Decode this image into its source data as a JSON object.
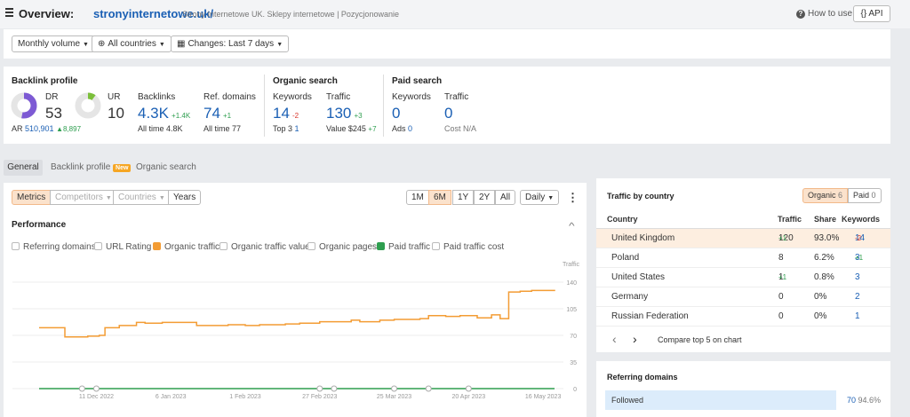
{
  "header": {
    "title_prefix": "Overview:",
    "domain": "stronyinternetowe.uk/",
    "description": "Strony Internetowe UK. Sklepy internetowe | Pozycjonowanie",
    "how_to_use": "How to use",
    "api": "{} API"
  },
  "filters": {
    "volume": "Monthly volume",
    "countries": "All countries",
    "changes": "Changes: Last 7 days"
  },
  "overview": {
    "backlink_profile": {
      "title": "Backlink profile",
      "dr_label": "DR",
      "dr_value": "53",
      "ur_label": "UR",
      "ur_value": "10",
      "backlinks_label": "Backlinks",
      "backlinks_value": "4.3K",
      "backlinks_delta": "+1.4K",
      "backlinks_alltime": "All time 4.8K",
      "refdomains_label": "Ref. domains",
      "refdomains_value": "74",
      "refdomains_delta": "+1",
      "refdomains_alltime": "All time 77",
      "ar_label": "AR",
      "ar_value": "510,901",
      "ar_delta": "▲8,897"
    },
    "organic_search": {
      "title": "Organic search",
      "keywords_label": "Keywords",
      "keywords_value": "14",
      "keywords_delta": "-2",
      "top3_label": "Top 3",
      "top3_value": "1",
      "traffic_label": "Traffic",
      "traffic_value": "130",
      "traffic_delta": "+3",
      "value_label": "Value",
      "value_value": "$245",
      "value_delta": "+7"
    },
    "paid_search": {
      "title": "Paid search",
      "keywords_label": "Keywords",
      "keywords_value": "0",
      "ads_label": "Ads",
      "ads_value": "0",
      "traffic_label": "Traffic",
      "traffic_value": "0",
      "cost_label": "Cost",
      "cost_value": "N/A"
    }
  },
  "tabs": {
    "general": "General",
    "backlink_profile": "Backlink profile",
    "new_badge": "New",
    "organic_search": "Organic search"
  },
  "chart_controls": {
    "metrics": "Metrics",
    "competitors": "Competitors",
    "countries": "Countries",
    "years": "Years",
    "ranges": [
      "1M",
      "6M",
      "1Y",
      "2Y",
      "All"
    ],
    "interval": "Daily",
    "more": "⋮",
    "performance": "Performance",
    "collapse": "^"
  },
  "legend": {
    "referring_domains": "Referring domains",
    "url_rating": "URL Rating",
    "organic_traffic": "Organic traffic",
    "organic_traffic_value": "Organic traffic value",
    "organic_pages": "Organic pages",
    "paid_traffic": "Paid traffic",
    "paid_traffic_cost": "Paid traffic cost"
  },
  "chart_data": {
    "type": "line",
    "y_axis_label": "Traffic",
    "yticks": [
      "140",
      "105",
      "70",
      "35",
      "0"
    ],
    "ylim": [
      0,
      140
    ],
    "xticks": [
      "11 Dec 2022",
      "6 Jan 2023",
      "1 Feb 2023",
      "27 Feb 2023",
      "25 Mar 2023",
      "20 Apr 2023",
      "16 May 2023"
    ],
    "series": [
      {
        "name": "Organic traffic",
        "color": "#f39c34",
        "x": [
          "2022-11-21",
          "2022-11-28",
          "2022-11-30",
          "2022-12-04",
          "2022-12-08",
          "2022-12-12",
          "2022-12-14",
          "2022-12-19",
          "2022-12-25",
          "2022-12-28",
          "2023-01-03",
          "2023-01-10",
          "2023-01-15",
          "2023-01-20",
          "2023-01-26",
          "2023-02-01",
          "2023-02-06",
          "2023-02-10",
          "2023-02-15",
          "2023-02-20",
          "2023-02-27",
          "2023-03-04",
          "2023-03-10",
          "2023-03-13",
          "2023-03-20",
          "2023-03-25",
          "2023-03-30",
          "2023-04-03",
          "2023-04-06",
          "2023-04-12",
          "2023-04-17",
          "2023-04-23",
          "2023-04-28",
          "2023-05-01",
          "2023-05-04",
          "2023-05-08",
          "2023-05-12",
          "2023-05-16",
          "2023-05-20"
        ],
        "y": [
          80,
          80,
          68,
          68,
          69,
          70,
          80,
          83,
          87,
          86,
          87,
          87,
          83,
          83,
          84,
          83,
          84,
          84,
          85,
          86,
          88,
          88,
          90,
          88,
          90,
          91,
          91,
          92,
          96,
          95,
          96,
          93,
          97,
          92,
          127,
          128,
          129,
          129,
          130
        ]
      },
      {
        "name": "Paid traffic",
        "color": "#2e9e4f",
        "x": [
          "2022-11-21",
          "2023-05-20"
        ],
        "y": [
          0,
          0
        ]
      }
    ],
    "annotations_x": [
      "2022-12-06",
      "2022-12-11",
      "2023-02-27",
      "2023-03-04",
      "2023-03-25",
      "2023-04-06",
      "2023-04-20"
    ]
  },
  "traffic_by_country": {
    "title": "Traffic by country",
    "organic_label": "Organic",
    "organic_count": "6",
    "paid_label": "Paid",
    "paid_count": "0",
    "columns": [
      "Country",
      "Traffic",
      "Share",
      "Keywords"
    ],
    "rows": [
      {
        "country": "United Kingdom",
        "traffic": "120",
        "traffic_delta": "+1",
        "share": "93.0%",
        "keywords": "14",
        "keywords_delta": "-2"
      },
      {
        "country": "Poland",
        "traffic": "8",
        "traffic_delta": "",
        "share": "6.2%",
        "keywords": "3",
        "keywords_delta": "+1"
      },
      {
        "country": "United States",
        "traffic": "1",
        "traffic_delta": "+1",
        "share": "0.8%",
        "keywords": "3",
        "keywords_delta": ""
      },
      {
        "country": "Germany",
        "traffic": "0",
        "traffic_delta": "",
        "share": "0%",
        "keywords": "2",
        "keywords_delta": ""
      },
      {
        "country": "Russian Federation",
        "traffic": "0",
        "traffic_delta": "",
        "share": "0%",
        "keywords": "1",
        "keywords_delta": ""
      }
    ],
    "prev": "‹",
    "next": "›",
    "compare": "Compare top 5 on chart"
  },
  "referring_domains": {
    "title": "Referring domains",
    "followed_label": "Followed",
    "followed_value": "70",
    "followed_share": "94.6%",
    "followed_fraction": 0.946
  }
}
